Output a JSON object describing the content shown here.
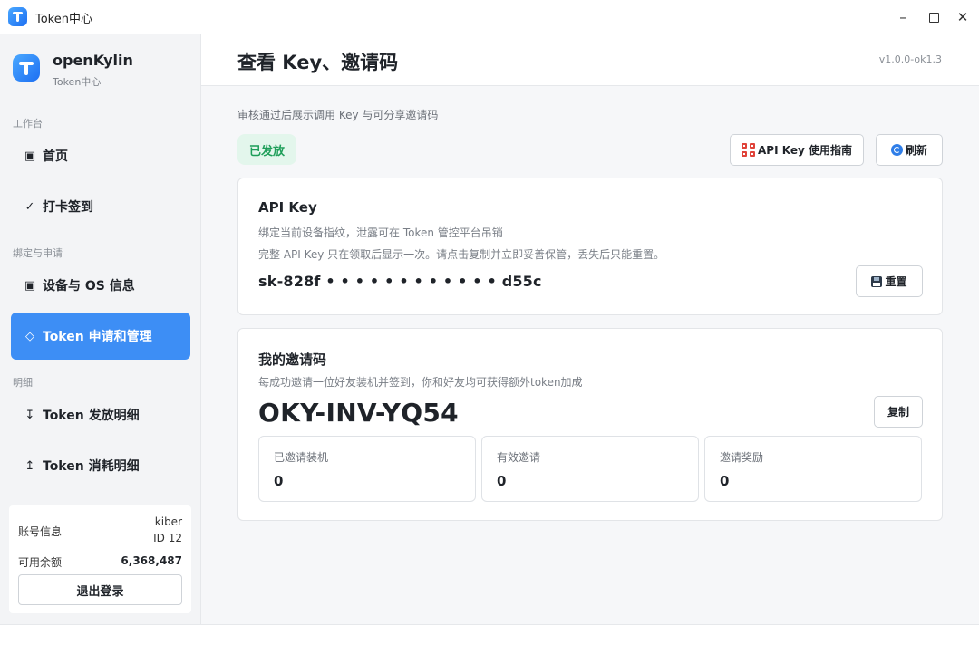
{
  "window": {
    "title": "Token中心",
    "controls": {
      "minimize": "–",
      "close": "✕"
    }
  },
  "sidebar": {
    "brand": {
      "name": "openKylin",
      "sub": "Token中心"
    },
    "sections": [
      {
        "label": "工作台"
      },
      {
        "label": "绑定与申请"
      },
      {
        "label": "明细"
      }
    ],
    "items": [
      {
        "icon": "▣",
        "label": "首页"
      },
      {
        "icon": "✓",
        "label": "打卡签到"
      },
      {
        "icon": "▣",
        "label": "设备与 OS 信息"
      },
      {
        "icon": "◇",
        "label": "Token 申请和管理",
        "active": true
      },
      {
        "icon": "↧",
        "label": "Token 发放明细"
      },
      {
        "icon": "↥",
        "label": "Token 消耗明细"
      }
    ],
    "account": {
      "label": "账号信息",
      "username": "kiber",
      "id": "ID 12",
      "balance_label": "可用余额",
      "balance": "6,368,487",
      "logout": "退出登录"
    }
  },
  "main": {
    "title": "查看 Key、邀请码",
    "version": "v1.0.0-ok1.3",
    "subtitle": "审核通过后展示调用 Key 与可分享邀请码",
    "status": "已发放",
    "guide_button": "API Key 使用指南",
    "refresh_button": "刷新",
    "api_card": {
      "title": "API Key",
      "desc1": "绑定当前设备指纹，泄露可在 Token 管控平台吊销",
      "desc2": "完整 API Key 只在领取后显示一次。请点击复制并立即妥善保管，丢失后只能重置。",
      "key": "sk-828f • • • • • • • • • • • • d55c",
      "reset_button": "重置"
    },
    "invite_card": {
      "title": "我的邀请码",
      "desc": "每成功邀请一位好友装机并签到，你和好友均可获得额外token加成",
      "code": "OKY-INV-YQ54",
      "copy_button": "复制",
      "stats": [
        {
          "label": "已邀请装机",
          "value": "0"
        },
        {
          "label": "有效邀请",
          "value": "0"
        },
        {
          "label": "邀请奖励",
          "value": "0"
        }
      ]
    }
  },
  "colors": {
    "accent": "#3d8ef5",
    "success_bg": "#e3f6ec",
    "success_text": "#1e9e59"
  }
}
